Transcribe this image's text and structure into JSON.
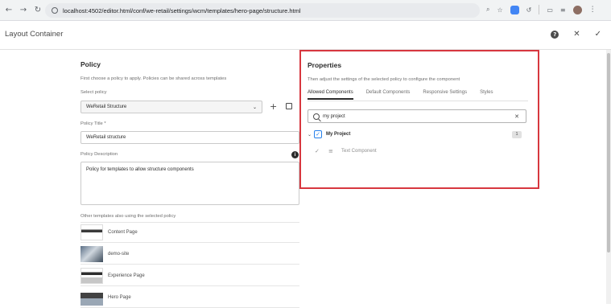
{
  "browser": {
    "back": "←",
    "forward": "→",
    "reload": "↻",
    "url": "localhost:4502/editor.html/conf/we-retail/settings/wcm/templates/hero-page/structure.html",
    "icons": [
      "zoom-icon",
      "star-icon",
      "extension-icon",
      "history-icon",
      "tab-icon",
      "cast-icon",
      "profile-avatar",
      "menu-icon"
    ]
  },
  "titlebar": {
    "title": "Layout Container",
    "help": "?",
    "close": "✕",
    "done": "✓"
  },
  "policy": {
    "heading": "Policy",
    "subtitle": "First choose a policy to apply. Policies can be shared across templates",
    "select_label": "Select policy",
    "select_value": "WeRetail Structure",
    "title_label": "Policy Title *",
    "title_value": "WeRetail structure",
    "desc_label": "Policy Description",
    "desc_value": "Policy for templates to allow structure components",
    "others_label": "Other templates also using the selected policy",
    "templates": [
      "Content Page",
      "demo-site",
      "Experience Page",
      "Hero Page"
    ]
  },
  "properties": {
    "heading": "Properties",
    "subtitle": "Then adjust the settings of the selected policy to configure the component",
    "tabs": [
      "Allowed Components",
      "Default Components",
      "Responsive Settings",
      "Styles"
    ],
    "search_value": "my project",
    "group_label": "My Project",
    "group_count": "1",
    "component_label": "Text Component"
  },
  "colors": {
    "accent_red": "#d7373f",
    "accent_blue": "#2680eb"
  }
}
